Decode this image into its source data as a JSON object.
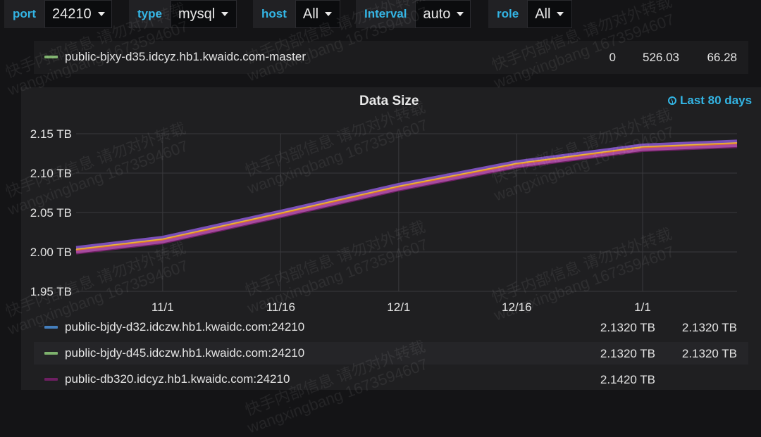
{
  "variables": [
    {
      "label": "port",
      "value": "24210"
    },
    {
      "label": "type",
      "value": "mysql"
    },
    {
      "label": "host",
      "value": "All"
    },
    {
      "label": "Interval",
      "value": "auto"
    },
    {
      "label": "role",
      "value": "All"
    }
  ],
  "top_legend": {
    "name": "public-bjxy-d35.idcyz.hb1.kwaidc.com-master",
    "color": "#7eb26d",
    "values": [
      "0",
      "526.03",
      "66.28"
    ]
  },
  "panel": {
    "title": "Data Size",
    "time_range": "Last 80 days"
  },
  "chart_data": {
    "type": "line",
    "title": "Data Size",
    "x_labels": [
      "11/1",
      "11/16",
      "12/1",
      "12/16",
      "1/1"
    ],
    "y_ticks": [
      "1.95 TB",
      "2.00 TB",
      "2.05 TB",
      "2.10 TB",
      "2.15 TB"
    ],
    "ylim": [
      1.95,
      2.15
    ],
    "y_unit": "TB",
    "grid": true,
    "series_colors": [
      "#6d1f62",
      "#a64a9e",
      "#7b4fb8",
      "#e0752d",
      "#eab839"
    ],
    "trend": {
      "dates": [
        "10/21",
        "11/1",
        "11/16",
        "12/1",
        "12/16",
        "1/1",
        "1/13"
      ],
      "values": [
        2.003,
        2.016,
        2.049,
        2.083,
        2.112,
        2.133,
        2.138
      ]
    }
  },
  "legend": [
    {
      "name": "public-bjdy-d32.idczw.hb1.kwaidc.com:24210",
      "color": "#447ebc",
      "values": [
        "2.1320 TB",
        "2.1320 TB"
      ]
    },
    {
      "name": "public-bjdy-d45.idczw.hb1.kwaidc.com:24210",
      "color": "#7eb26d",
      "values": [
        "2.1320 TB",
        "2.1320 TB"
      ]
    },
    {
      "name": "public-db320.idcyz.hb1.kwaidc.com:24210",
      "color": "#6d1f62",
      "values": [
        "2.1420 TB",
        ""
      ]
    }
  ],
  "watermark": [
    "快手内部信息 请勿对外转载",
    "wangxingbang 1673594607"
  ]
}
